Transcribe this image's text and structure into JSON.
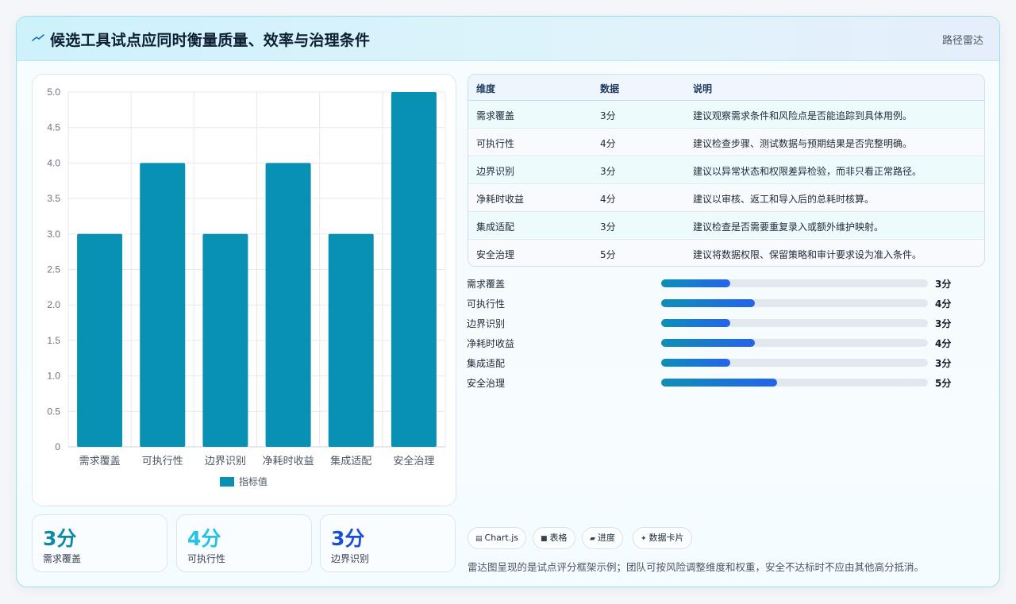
{
  "header": {
    "title": "候选工具试点应同时衡量质量、效率与治理条件",
    "tag": "路径雷达",
    "icon": "trend-line-icon"
  },
  "chart_data": {
    "type": "bar",
    "categories": [
      "需求覆盖",
      "可执行性",
      "边界识别",
      "净耗时收益",
      "集成适配",
      "安全治理"
    ],
    "series": [
      {
        "name": "指标值",
        "values": [
          3,
          4,
          3,
          4,
          3,
          5
        ]
      }
    ],
    "ylim": [
      0,
      5
    ],
    "yticks": [
      "0",
      "0.5",
      "1.0",
      "1.5",
      "2.0",
      "2.5",
      "3.0",
      "3.5",
      "4.0",
      "4.5",
      "5.0"
    ],
    "legend": "bottom",
    "grid": true,
    "color": "#0891b2"
  },
  "stats": [
    {
      "value": "3分",
      "label": "需求覆盖",
      "color": "#0e8aa7"
    },
    {
      "value": "4分",
      "label": "可执行性",
      "color": "#22c3e6"
    },
    {
      "value": "3分",
      "label": "边界识别",
      "color": "#1d4ed8"
    }
  ],
  "table": {
    "headers": [
      "维度",
      "数据",
      "说明"
    ],
    "rows": [
      [
        "需求覆盖",
        "3分",
        "建议观察需求条件和风险点是否能追踪到具体用例。"
      ],
      [
        "可执行性",
        "4分",
        "建议检查步骤、测试数据与预期结果是否完整明确。"
      ],
      [
        "边界识别",
        "3分",
        "建议以异常状态和权限差异检验，而非只看正常路径。"
      ],
      [
        "净耗时收益",
        "4分",
        "建议以审核、返工和导入后的总耗时核算。"
      ],
      [
        "集成适配",
        "3分",
        "建议检查是否需要重复录入或额外维护映射。"
      ],
      [
        "安全治理",
        "5分",
        "建议将数据权限、保留策略和审计要求设为准入条件。"
      ]
    ]
  },
  "progress": [
    {
      "label": "需求覆盖",
      "value": "3分",
      "fraction": 0.26
    },
    {
      "label": "可执行性",
      "value": "4分",
      "fraction": 0.35
    },
    {
      "label": "边界识别",
      "value": "3分",
      "fraction": 0.26
    },
    {
      "label": "净耗时收益",
      "value": "4分",
      "fraction": 0.35
    },
    {
      "label": "集成适配",
      "value": "3分",
      "fraction": 0.26
    },
    {
      "label": "安全治理",
      "value": "5分",
      "fraction": 0.435
    }
  ],
  "chips": [
    {
      "icon": "chart-icon",
      "glyph": "▤",
      "label": "Chart.js"
    },
    {
      "icon": "table-icon",
      "glyph": "■",
      "label": "表格"
    },
    {
      "icon": "progress-icon",
      "glyph": "▰",
      "label": "进度"
    },
    {
      "icon": "sparkle-icon",
      "glyph": "✦",
      "label": "数据卡片"
    }
  ],
  "note": "雷达图呈现的是试点评分框架示例；团队可按风险调整维度和权重，安全不达标时不应由其他高分抵消。"
}
